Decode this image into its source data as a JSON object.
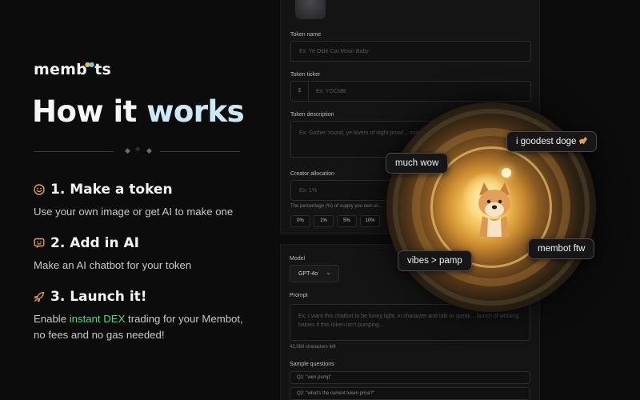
{
  "brand": {
    "prefix": "memb",
    "suffix": "ts"
  },
  "headline": {
    "part1": "How it ",
    "part2": "works"
  },
  "steps": [
    {
      "title": "1. Make a token",
      "icon": "smiley-icon",
      "desc": "Use your own image or get AI to make one"
    },
    {
      "title": "2. Add in AI",
      "icon": "chat-icon",
      "desc": "Make an AI chatbot for your token"
    },
    {
      "title": "3. Launch it!",
      "icon": "rocket-icon",
      "desc_pre": "Enable ",
      "desc_hl": "instant DEX",
      "desc_post": " trading for your Membot,",
      "desc_line2": "no fees and no gas needed!"
    }
  ],
  "form": {
    "token_name_label": "Token name",
    "token_name_placeholder": "Ex: Ye Olde Cat Moon Baby",
    "ticker_label": "Token ticker",
    "ticker_prefix": "$",
    "ticker_placeholder": "Ex: YOCMB",
    "description_label": "Token description",
    "description_placeholder": "Ex: Gather 'round, ye lovers of night prowl... most bewitching spectacle of the crypt...",
    "allocation_label": "Creator allocation",
    "allocation_placeholder": "Ex: 1%",
    "allocation_hint": "The percentage (%) of supply you own al...",
    "allocation_chips": [
      "0%",
      "1%",
      "5%",
      "10%"
    ],
    "model_label": "Model",
    "model_value": "GPT-4o",
    "prompt_label": "Prompt",
    "prompt_placeholder": "Ex: I want this chatbot to be funny light, in character and talk to speak... bunch of whining babies if this token isn't pumping...",
    "char_count": "42,069 characters left",
    "sample_label": "Sample questions",
    "questions": [
      "Q1: \"wen pump\"",
      "Q2: \"what's the current token price?\""
    ]
  },
  "bubbles": {
    "b1": "much wow",
    "b2": "i goodest doge",
    "b3": "vibes > pamp",
    "b4": "membot ftw"
  },
  "colors": {
    "accent_green": "#49d98c",
    "accent_orange": "#e9a34a",
    "accent_blue": "#cbe8f5",
    "background": "#0c0c0d"
  }
}
